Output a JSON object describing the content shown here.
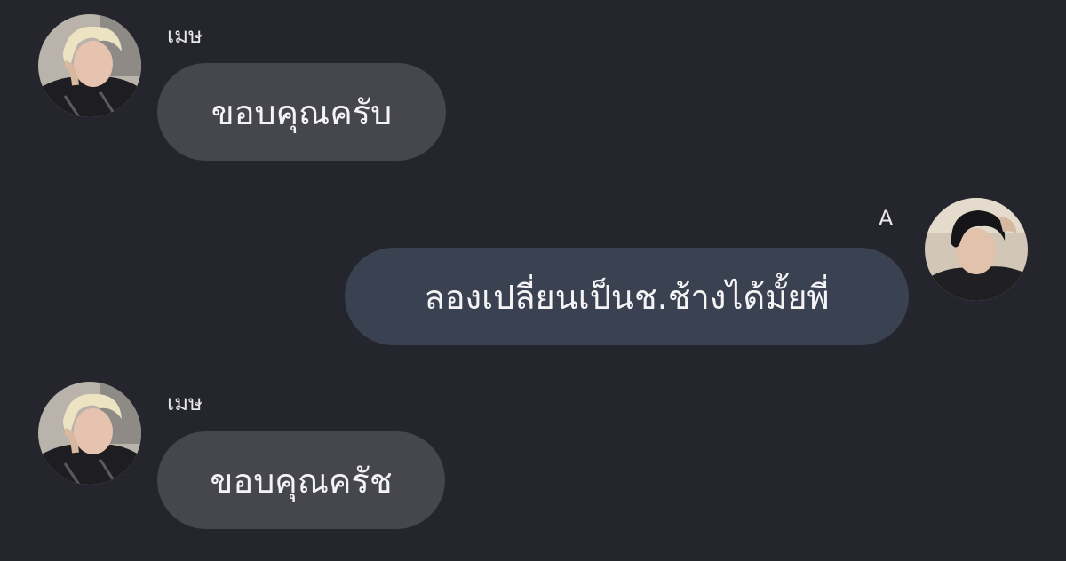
{
  "messages": [
    {
      "sender": "เมษ",
      "text": "ขอบคุณครับ",
      "direction": "incoming",
      "avatar_icon": "avatar-blond-person-icon"
    },
    {
      "sender": "A",
      "text": "ลองเปลี่ยนเป็นช.ช้างได้มั้ยพี่",
      "direction": "outgoing",
      "avatar_icon": "avatar-dark-hair-person-icon"
    },
    {
      "sender": "เมษ",
      "text": "ขอบคุณครัช",
      "direction": "incoming",
      "avatar_icon": "avatar-blond-person-icon"
    }
  ],
  "colors": {
    "background": "#25262d",
    "incoming_bubble": "#45464e",
    "outgoing_bubble": "#3a4151",
    "text": "#f4f4f6"
  }
}
